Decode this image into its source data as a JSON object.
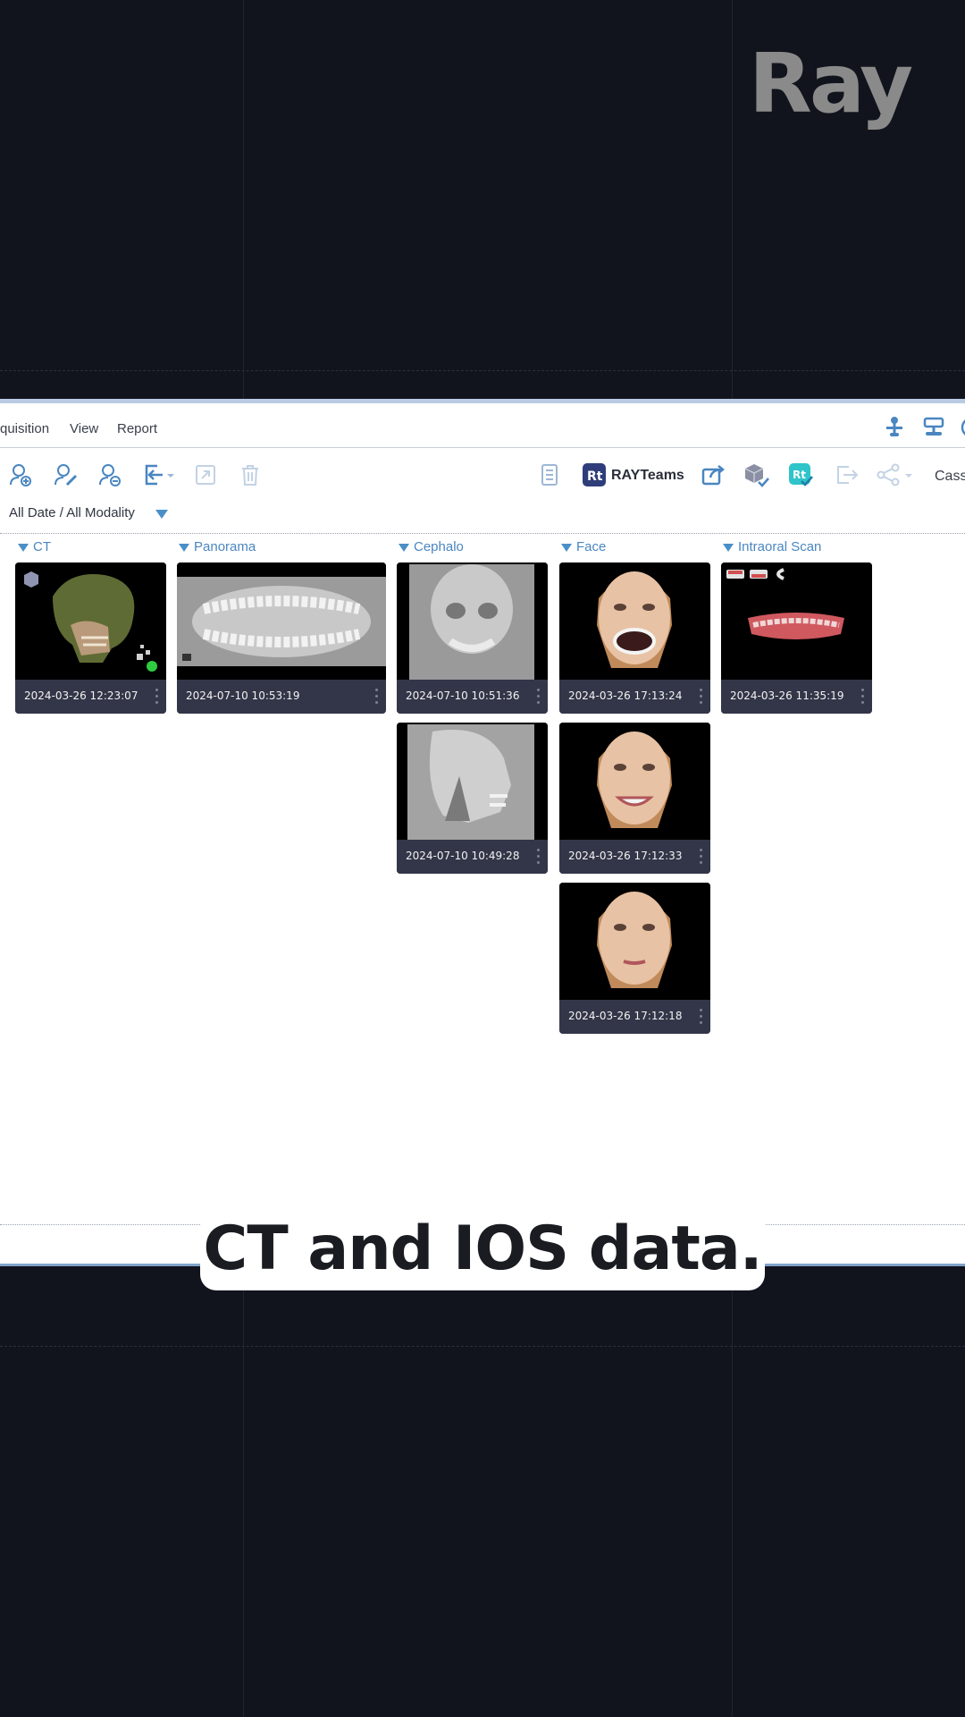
{
  "brand": {
    "logo_text": "Ray"
  },
  "menu": {
    "items": [
      "quisition",
      "View",
      "Report"
    ]
  },
  "toolbar": {
    "rayteams_label": "RAYTeams",
    "cass_label": "Cass",
    "icons": [
      "add-patient-icon",
      "edit-patient-icon",
      "remove-patient-icon",
      "import-icon",
      "export-icon",
      "trash-icon",
      "document-icon",
      "rayteams-logo-icon",
      "share-out-icon",
      "cube-check-icon",
      "rayteams-check-icon",
      "exit-icon",
      "share-icon"
    ]
  },
  "filter": {
    "label": "All Date / All Modality"
  },
  "columns": [
    {
      "title": "CT",
      "cards": [
        {
          "date": "2024-03-26 12:23:07",
          "thumb": "ct-3d-skull"
        }
      ]
    },
    {
      "title": "Panorama",
      "cards": [
        {
          "date": "2024-07-10 10:53:19",
          "thumb": "panoramic-xray"
        }
      ]
    },
    {
      "title": "Cephalo",
      "cards": [
        {
          "date": "2024-07-10 10:51:36",
          "thumb": "frontal-ceph-xray"
        },
        {
          "date": "2024-07-10 10:49:28",
          "thumb": "lateral-ceph-xray"
        }
      ]
    },
    {
      "title": "Face",
      "cards": [
        {
          "date": "2024-03-26 17:13:24",
          "thumb": "face-retractor"
        },
        {
          "date": "2024-03-26 17:12:33",
          "thumb": "face-smile"
        },
        {
          "date": "2024-03-26 17:12:18",
          "thumb": "face-neutral"
        }
      ]
    },
    {
      "title": "Intraoral Scan",
      "cards": [
        {
          "date": "2024-03-26 11:35:19",
          "thumb": "intraoral-scan"
        }
      ]
    }
  ],
  "caption": {
    "text": "CT and IOS data."
  },
  "colors": {
    "background": "#12141d",
    "accent": "#4a86c0",
    "card_bar": "#333648"
  }
}
